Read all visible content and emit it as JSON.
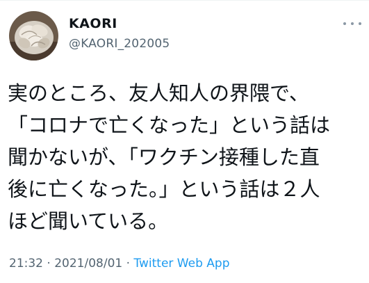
{
  "tweet": {
    "author": {
      "display_name": "KAORI",
      "handle": "@KAORI_202005",
      "avatar_icon": "desert-rose-avatar"
    },
    "more_icon": "more-horizontal-icon",
    "text_lines": [
      "実のところ、友人知人の界隈で、",
      "「コロナで亡くなった」という話は",
      "聞かないが、「ワクチン接種した直",
      "後に亡くなった。」という話は２人",
      "ほど聞いている。"
    ],
    "meta": {
      "time": "21:32",
      "separator": " · ",
      "date": "2021/08/01",
      "separator2": " · ",
      "source": "Twitter Web App"
    }
  },
  "colors": {
    "text": "#0f1419",
    "secondary": "#536471",
    "link": "#1d9bf0",
    "divider": "#eff3f4"
  }
}
